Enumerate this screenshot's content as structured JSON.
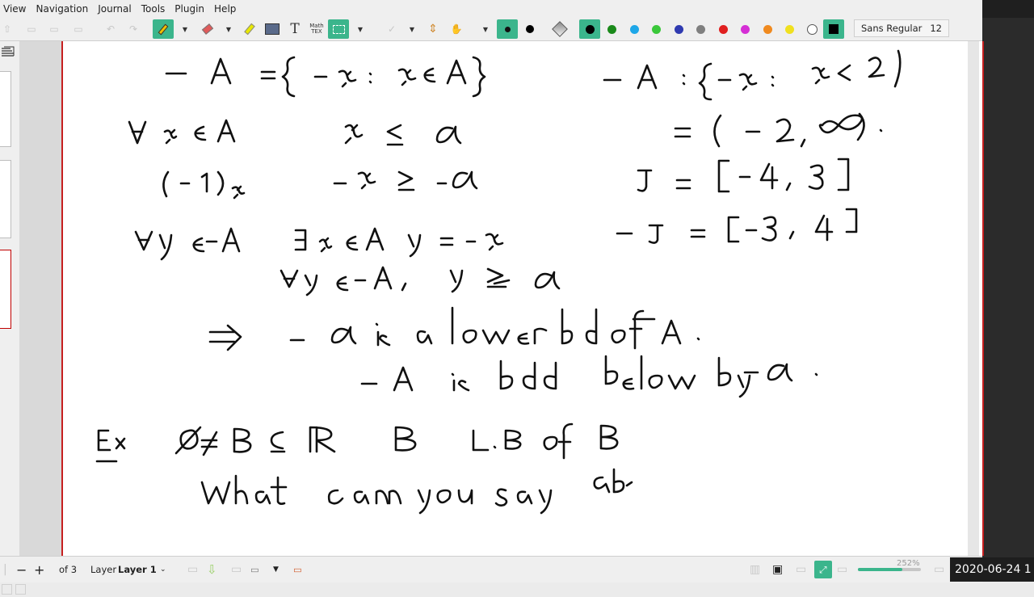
{
  "menu": {
    "items": [
      "View",
      "Navigation",
      "Journal",
      "Tools",
      "Plugin",
      "Help"
    ]
  },
  "toolbar": {
    "math_tex_label": "Math\nTeX",
    "font_name": "Sans Regular",
    "font_size": "12",
    "colors": [
      "#000000",
      "#1a8a1a",
      "#1ea7e8",
      "#3ac83a",
      "#2f3ab0",
      "#7f7f7f",
      "#e01f1f",
      "#d52fd5",
      "#f08a1f",
      "#f0e01f",
      "#ffffff"
    ],
    "active_color_box": "#000000",
    "accent": "#3bb58c"
  },
  "status": {
    "page_of": "of 3",
    "layer_label": "Layer",
    "layer_value": "Layer 1",
    "zoom": "252%",
    "zoom_fraction": 0.7
  },
  "datetime": "2020-06-24 1",
  "page": {
    "ink_lines": [
      "− A = { − x : x ∈ A }",
      "− A : { − x : x < 2 }",
      "∀ x ∈ A   x ≤ α",
      "= ( − 2 , ∞ ) .",
      "( − 1 ) x   − x ≥ − α",
      "J = [ − 4 , 3 ]",
      "∀ y ∈ − A   ∃ x ∈ A  y = − x",
      "− J = [ − 3 , 4 ]",
      "∀ y ∈ − A ,  y ≥ − α",
      "⇒  − α is a lower bd of − A .",
      "− A is bdd below by − α .",
      "Ex   ∅ ≠ B ⊆ ℝ    B  L.B of B",
      "What can you say ab"
    ]
  }
}
